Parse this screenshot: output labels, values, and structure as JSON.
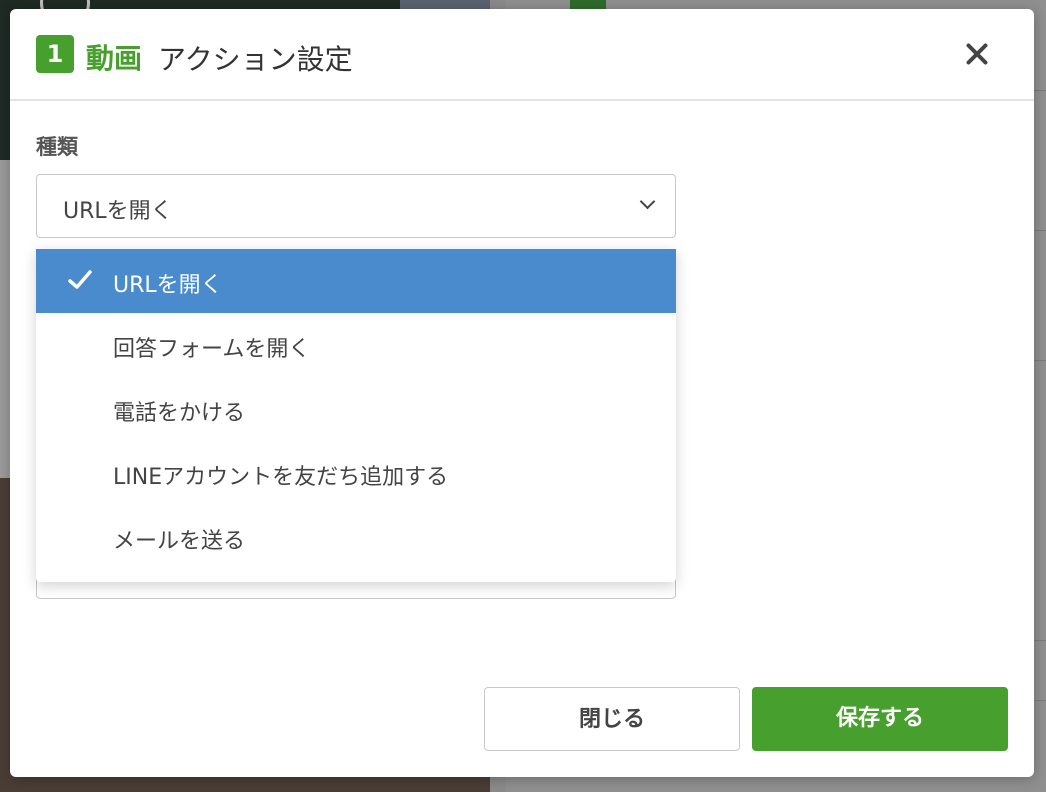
{
  "modal": {
    "step_number": "1",
    "element_type": "動画",
    "title": "アクション設定",
    "close_icon": "close-icon"
  },
  "action_type": {
    "label": "種類",
    "selected_value": "URLを開く",
    "options": [
      {
        "label": "URLを開く",
        "selected": true
      },
      {
        "label": "回答フォームを開く",
        "selected": false
      },
      {
        "label": "電話をかける",
        "selected": false
      },
      {
        "label": "LINEアカウントを友だち追加する",
        "selected": false
      },
      {
        "label": "メールを送る",
        "selected": false
      }
    ]
  },
  "footer": {
    "close_label": "閉じる",
    "save_label": "保存する"
  },
  "colors": {
    "accent_green": "#47a02e",
    "selected_option_blue": "#4a8bcd"
  }
}
